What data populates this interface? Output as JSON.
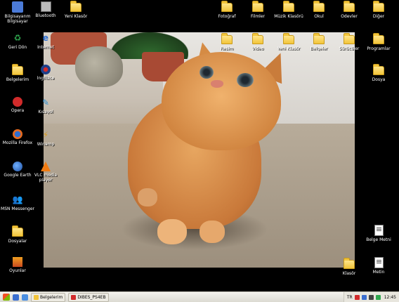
{
  "desktop": {
    "icons_left": [
      {
        "name": "my-computer",
        "label": "Bilgisayarım Bilgisayar",
        "icon": "computer-icon",
        "color": "#4b7bd8"
      },
      {
        "name": "recycle-bin",
        "label": "Geri Dön",
        "icon": "recycle-bin-icon",
        "color": "#2fa84f"
      },
      {
        "name": "my-documents",
        "label": "Belgelerim",
        "icon": "documents-icon",
        "color": "#f2c43a"
      },
      {
        "name": "opera",
        "label": "Opera",
        "icon": "opera-icon",
        "color": "#d12b2b"
      },
      {
        "name": "mozilla-firefox",
        "label": "Mozilla Firefox",
        "icon": "firefox-icon",
        "color": "#e66a1f"
      },
      {
        "name": "google-earth",
        "label": "Google Earth",
        "icon": "globe-icon",
        "color": "#2f6fd0"
      },
      {
        "name": "msn-messenger",
        "label": "MSN Messenger",
        "icon": "messenger-icon",
        "color": "#3aa34a"
      },
      {
        "name": "folder-bottom",
        "label": "Dosyalar",
        "icon": "folder-icon",
        "color": "#f2c43a"
      },
      {
        "name": "game-icon",
        "label": "Oyunlar",
        "icon": "game-icon",
        "color": "#c94a1f"
      }
    ],
    "icons_col2": [
      {
        "name": "bluetooth",
        "label": "Bluetooth",
        "icon": "bluetooth-icon",
        "color": "#6a6a6a"
      },
      {
        "name": "internet-explorer",
        "label": "İnternet",
        "icon": "ie-icon",
        "color": "#2f6fd0"
      },
      {
        "name": "english-dictionary",
        "label": "İngilizce",
        "icon": "flag-uk-icon",
        "color": "#1e3f8a"
      },
      {
        "name": "shortcut-app",
        "label": "Kısayol",
        "icon": "app-icon",
        "color": "#2f8fd0"
      },
      {
        "name": "winamp",
        "label": "Winamp",
        "icon": "winamp-icon",
        "color": "#d69b1f"
      },
      {
        "name": "vlc-player",
        "label": "VLC media player",
        "icon": "vlc-icon",
        "color": "#f07b13"
      }
    ],
    "icons_top_row3": [
      {
        "name": "folder-top-3",
        "label": "Yeni Klasör",
        "icon": "folder-icon",
        "color": "#f2c43a"
      }
    ],
    "icons_top_right": [
      {
        "name": "folder-tr-1",
        "label": "Fotoğraf",
        "icon": "folder-icon",
        "color": "#f2c43a"
      },
      {
        "name": "folder-tr-2",
        "label": "Filmler",
        "icon": "folder-icon",
        "color": "#f2c43a"
      },
      {
        "name": "folder-tr-3",
        "label": "Müzik Klasörü",
        "icon": "folder-icon",
        "color": "#f2c43a"
      },
      {
        "name": "folder-tr-4",
        "label": "Okul",
        "icon": "folder-icon",
        "color": "#f2c43a"
      },
      {
        "name": "folder-tr-5",
        "label": "Ödevler",
        "icon": "folder-icon",
        "color": "#f2c43a"
      },
      {
        "name": "folder-tr-6",
        "label": "Diğer",
        "icon": "folder-icon",
        "color": "#f2c43a"
      }
    ],
    "icons_second_row": [
      {
        "name": "folder-r2-1",
        "label": "Resim",
        "icon": "folder-icon",
        "color": "#f2c43a"
      },
      {
        "name": "folder-r2-2",
        "label": "Video",
        "icon": "folder-icon",
        "color": "#f2c43a"
      },
      {
        "name": "folder-r2-3",
        "label": "Yeni Klasör",
        "icon": "folder-icon",
        "color": "#f2c43a"
      },
      {
        "name": "folder-r2-4",
        "label": "Belgeler",
        "icon": "folder-icon",
        "color": "#f2c43a"
      },
      {
        "name": "folder-r2-5",
        "label": "Sürücüler",
        "icon": "folder-icon",
        "color": "#f2c43a"
      },
      {
        "name": "folder-r2-6",
        "label": "Programlar",
        "icon": "folder-icon",
        "color": "#f2c43a"
      }
    ],
    "icon_right_3": {
      "name": "folder-r3",
      "label": "Dosya",
      "icon": "folder-icon",
      "color": "#f2c43a"
    },
    "icon_right_bottom_1": {
      "name": "doc-right-1",
      "label": "Belge Metni",
      "icon": "document-icon"
    },
    "icon_right_bottom_2": {
      "name": "doc-right-2",
      "label": "Metin",
      "icon": "document-icon"
    },
    "icon_bottom_folder": {
      "name": "folder-bottom-right",
      "label": "Klasör",
      "icon": "folder-icon",
      "color": "#f2c43a"
    }
  },
  "taskbar": {
    "tasks": [
      {
        "name": "task-folder",
        "label": "Belgelerim",
        "icon_color": "#f2c43a"
      },
      {
        "name": "task-app",
        "label": "DIBES_PS4EB",
        "icon_color": "#d12b2b"
      }
    ],
    "tray_lang": "TR",
    "clock": "12:45"
  }
}
